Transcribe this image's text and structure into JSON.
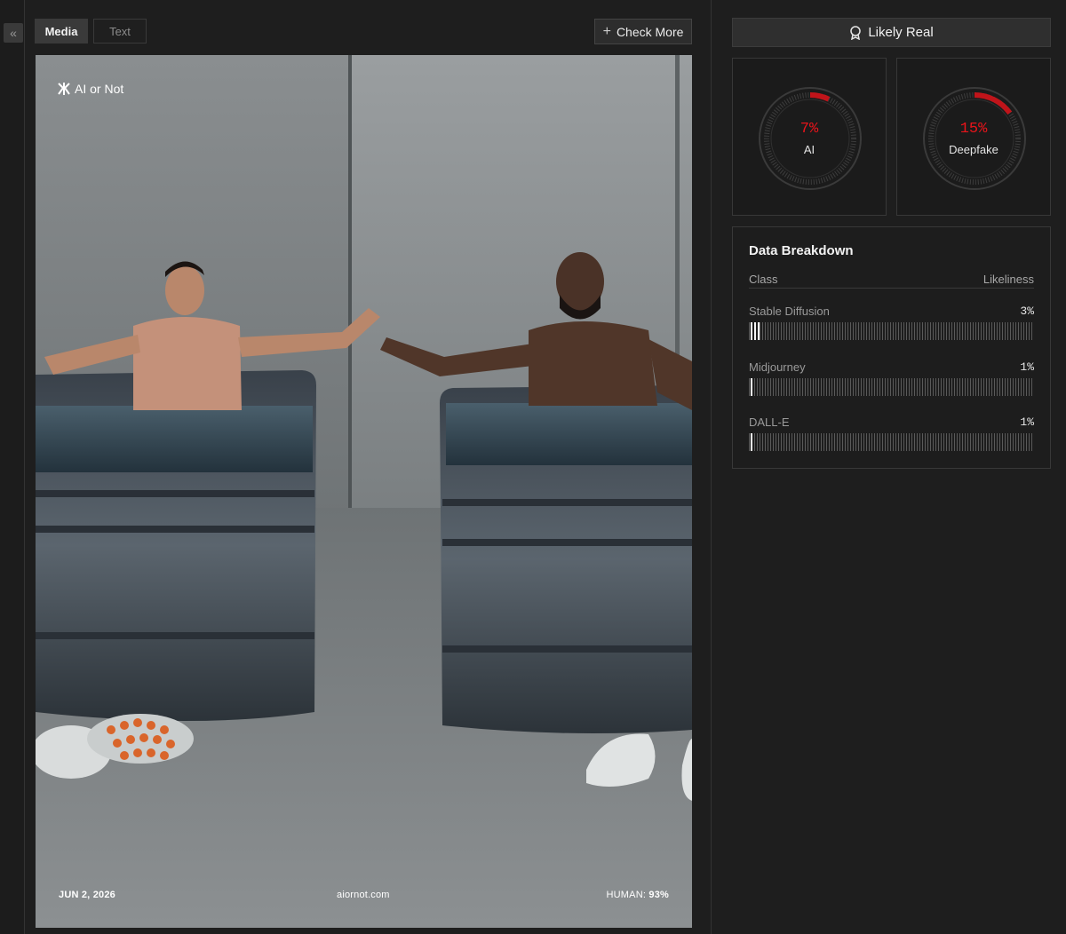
{
  "tabs": {
    "media": "Media",
    "text": "Text"
  },
  "toolbar": {
    "check_more": "Check More"
  },
  "image": {
    "brand": "AI or Not",
    "date": "JUN 2, 2026",
    "site": "aiornot.com",
    "human_label": "HUMAN:",
    "human_value": "93%"
  },
  "verdict": {
    "label": "Likely Real"
  },
  "gauges": [
    {
      "value": "7%",
      "label": "AI",
      "fraction": 0.07
    },
    {
      "value": "15%",
      "label": "Deepfake",
      "fraction": 0.15
    }
  ],
  "colors": {
    "accent": "#e8141a",
    "panel": "#1e1e1e"
  },
  "breakdown": {
    "title": "Data Breakdown",
    "col_class": "Class",
    "col_likeliness": "Likeliness",
    "rows": [
      {
        "name": "Stable Diffusion",
        "pct": "3%",
        "fraction": 0.03
      },
      {
        "name": "Midjourney",
        "pct": "1%",
        "fraction": 0.01
      },
      {
        "name": "DALL-E",
        "pct": "1%",
        "fraction": 0.01
      }
    ]
  }
}
